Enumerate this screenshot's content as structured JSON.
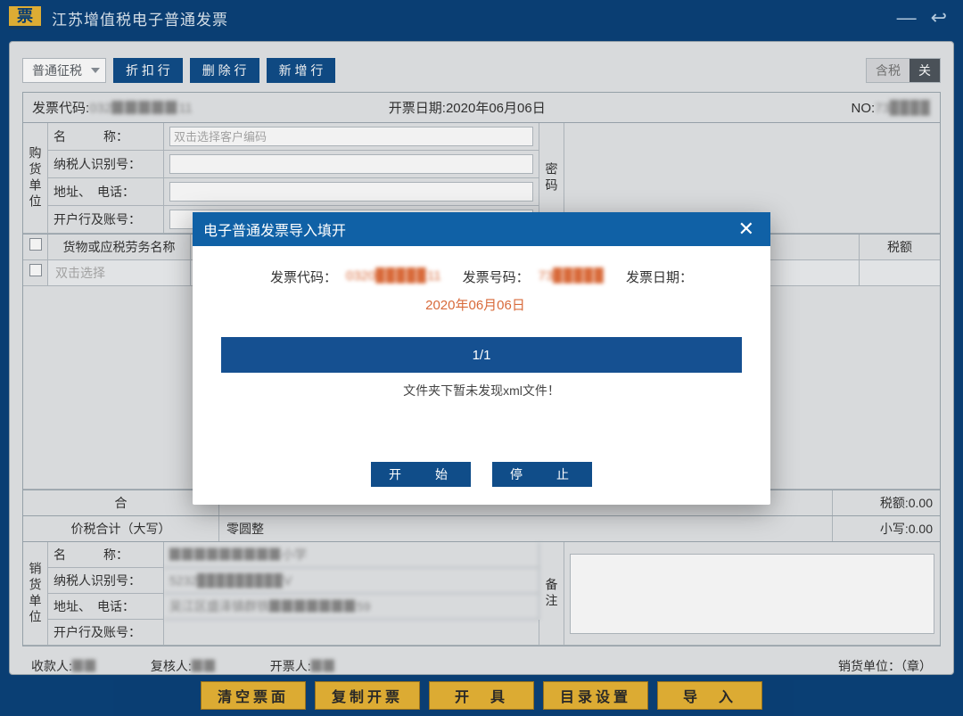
{
  "titlebar": {
    "logo_text": "票",
    "title": "江苏增值税电子普通发票"
  },
  "toprow": {
    "tax_mode": "普通征税",
    "discount_btn": "折 扣 行",
    "delete_btn": "删 除 行",
    "add_btn": "新 增 行",
    "tax_incl_label": "含税",
    "close_label": "关"
  },
  "header_info": {
    "code_label": "发票代码:",
    "code_value": "032▉▉▉▉▉11",
    "date_label": "开票日期:",
    "date_value": "2020年06月06日",
    "no_label": "NO:",
    "no_value": "73▉▉▉▉"
  },
  "buyer": {
    "section_label": "购货单位",
    "name_label": "名　　　称：",
    "name_placeholder": "双击选择客户编码",
    "taxid_label": "纳税人识别号：",
    "addr_label": "地址、　电话：",
    "bank_label": "开户行及账号：",
    "password_label": "密码"
  },
  "items_table": {
    "col_goods": "货物或应税劳务名称",
    "col_tax_amount": "税额",
    "row_placeholder": "双击选择"
  },
  "totals": {
    "sum_label": "合",
    "tax_total_label": "税额:",
    "tax_total_value": "0.00",
    "grand_label": "价税合计（大写）",
    "grand_cn": "零圆整",
    "small_label": "小写:",
    "small_value": "0.00"
  },
  "seller": {
    "section_label": "销货单位",
    "name_label": "名　　　称：",
    "name_value": "▉▉▉▉▉▉▉▉▉小学",
    "taxid_label": "纳税人识别号：",
    "taxid_value": "5232▉▉▉▉▉▉▉▉▉V",
    "addr_label": "地址、　电话：",
    "addr_value": "吴江区盛泽镇群铁▉▉▉▉▉▉▉59",
    "bank_label": "开户行及账号：",
    "remark_label": "备注"
  },
  "signatures": {
    "payee_label": "收款人:",
    "payee_value": "▉▉",
    "reviewer_label": "复核人:",
    "reviewer_value": "▉▉",
    "issuer_label": "开票人:",
    "issuer_value": "▉▉",
    "seller_unit_label": "销货单位：（章）"
  },
  "bottom_buttons": {
    "clear": "清空票面",
    "copy": "复制开票",
    "issue": "开　具",
    "dir": "目录设置",
    "import": "导　入"
  },
  "modal": {
    "title": "电子普通发票导入填开",
    "code_label": "发票代码：",
    "code_value": "0320▉▉▉▉▉11",
    "num_label": "发票号码：",
    "num_value": "73▉▉▉▉▉",
    "date_label": "发票日期：",
    "date_value": "2020年06月06日",
    "progress_text": "1/1",
    "message": "文件夹下暂未发现xml文件！",
    "start_btn": "开　始",
    "stop_btn": "停　止"
  }
}
